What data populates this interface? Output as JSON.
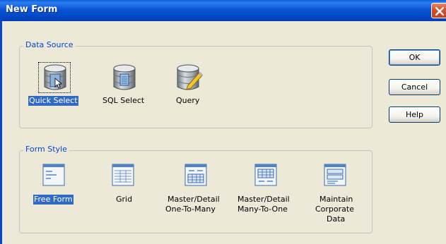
{
  "window": {
    "title": "New Form"
  },
  "data_source": {
    "legend": "Data Source",
    "options": [
      {
        "label": "Quick Select",
        "icon": "database-quick-select-icon",
        "selected": true
      },
      {
        "label": "SQL Select",
        "icon": "database-sql-select-icon",
        "selected": false
      },
      {
        "label": "Query",
        "icon": "database-query-icon",
        "selected": false
      }
    ]
  },
  "form_style": {
    "legend": "Form Style",
    "options": [
      {
        "label": "Free Form",
        "icon": "free-form-icon",
        "selected": true
      },
      {
        "label": "Grid",
        "icon": "grid-icon",
        "selected": false
      },
      {
        "label_lines": [
          "Master/Detail",
          "One-To-Many"
        ],
        "icon": "master-detail-one-to-many-icon",
        "selected": false
      },
      {
        "label_lines": [
          "Master/Detail",
          "Many-To-One"
        ],
        "icon": "master-detail-many-to-one-icon",
        "selected": false
      },
      {
        "label_lines": [
          "Maintain",
          "Corporate",
          "Data"
        ],
        "icon": "maintain-corporate-data-icon",
        "selected": false
      }
    ]
  },
  "buttons": {
    "ok": "OK",
    "cancel": "Cancel",
    "help": "Help"
  },
  "colors": {
    "selection": "#316ac5",
    "group_label": "#0046d5",
    "titlebar": "#0a55d6",
    "dialog_bg": "#ece9d8"
  }
}
